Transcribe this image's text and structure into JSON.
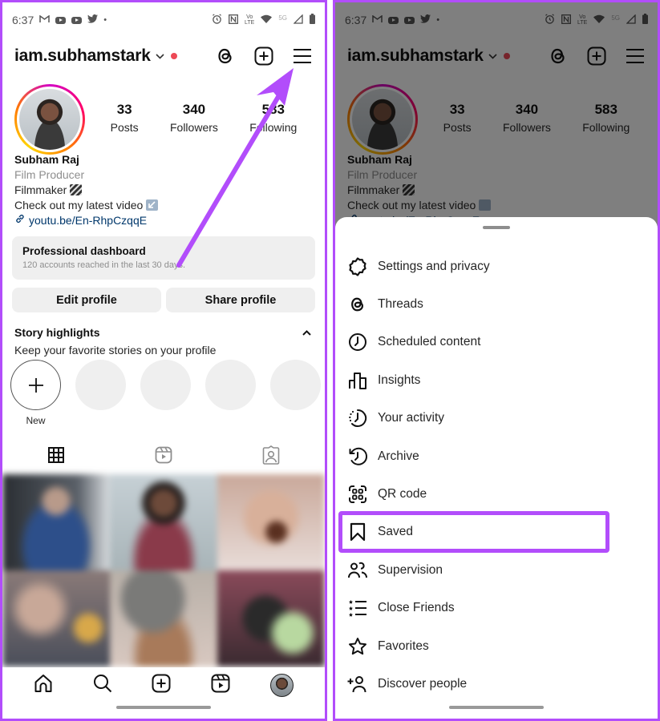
{
  "status_bar": {
    "time": "6:37",
    "left_icons": [
      "gmail-icon",
      "youtube-icon",
      "youtube-icon",
      "twitter-icon",
      "dot-icon"
    ],
    "right_icons": [
      "alarm-icon",
      "nfc-icon",
      "volte-icon",
      "wifi-icon",
      "5g-icon",
      "signal-icon",
      "battery-icon"
    ],
    "network_label": "5G",
    "volte_label": "Vo LTE"
  },
  "profile": {
    "username": "iam.subhamstark",
    "stats": [
      {
        "value": "33",
        "label": "Posts"
      },
      {
        "value": "340",
        "label": "Followers"
      },
      {
        "value": "583",
        "label": "Following"
      }
    ],
    "name": "Subham Raj",
    "category": "Film Producer",
    "bio_lines": [
      "Filmmaker 🎬",
      "Check out my latest video ↙️"
    ],
    "bio_line1_text": "Filmmaker",
    "bio_line2_text": "Check out my latest video",
    "link": "youtu.be/En-RhpCzqqE"
  },
  "professional_dashboard": {
    "title": "Professional dashboard",
    "subtitle": "120 accounts reached in the last 30 days."
  },
  "buttons": {
    "edit_profile": "Edit profile",
    "share_profile": "Share profile"
  },
  "story_highlights": {
    "title": "Story highlights",
    "subtitle": "Keep your favorite stories on your profile",
    "new_label": "New",
    "placeholder_count": 4
  },
  "profile_tabs": [
    "grid-icon",
    "reels-icon",
    "tagged-icon"
  ],
  "bottom_nav": [
    "home-icon",
    "search-icon",
    "create-icon",
    "reels-icon",
    "profile-avatar"
  ],
  "menu": {
    "items": [
      {
        "label": "Settings and privacy",
        "icon": "settings-icon"
      },
      {
        "label": "Threads",
        "icon": "threads-icon"
      },
      {
        "label": "Scheduled content",
        "icon": "clock-icon"
      },
      {
        "label": "Insights",
        "icon": "insights-icon"
      },
      {
        "label": "Your activity",
        "icon": "activity-icon"
      },
      {
        "label": "Archive",
        "icon": "archive-icon"
      },
      {
        "label": "QR code",
        "icon": "qr-code-icon"
      },
      {
        "label": "Saved",
        "icon": "bookmark-icon"
      },
      {
        "label": "Supervision",
        "icon": "supervision-icon"
      },
      {
        "label": "Close Friends",
        "icon": "close-friends-icon"
      },
      {
        "label": "Favorites",
        "icon": "star-icon"
      },
      {
        "label": "Discover people",
        "icon": "add-person-icon"
      }
    ],
    "highlighted_item": "Saved"
  },
  "annotation": {
    "color": "#b24dfb",
    "arrow_target": "menu-button",
    "highlight_target": "Saved"
  },
  "colors": {
    "accent": "#b24dfb",
    "notification_dot": "#ed4956",
    "link": "#00376b",
    "secondary_text": "#8e8e8e",
    "button_bg": "#efefef"
  }
}
